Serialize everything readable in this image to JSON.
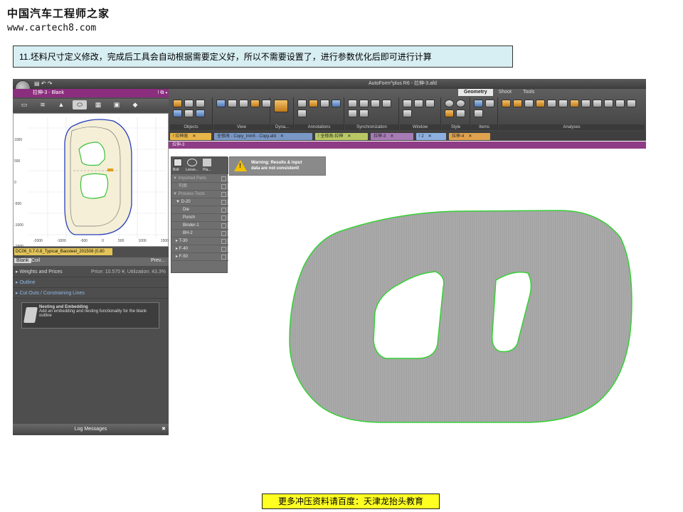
{
  "watermark": {
    "title_cn": "中国汽车工程师之家",
    "url": "www.cartech8.com"
  },
  "step_text": "11.坯料尺寸定义修改，完成后工具会自动根据需要定义好，所以不需要设置了，进行参数优化后即可进行计算",
  "footer_text": "更多冲压资料请百度：天津龙抬头教育",
  "app": {
    "window_title": "AutoForm^plus R6 - 拉伸-3.afd",
    "left_panel": {
      "header": "拉伸-3 - Blank",
      "tools": [
        "cube-icon",
        "layers-icon",
        "mountain-icon",
        "blank-outline-icon",
        "printer-icon",
        "monitor-icon",
        "shield-icon"
      ],
      "plot_label": "DC06_0.7-0.8_Typical_Baosteel_201508 (0.80 mm)",
      "y_ticks": [
        "1000",
        "500",
        "0",
        "-500",
        "-1000",
        "-1500"
      ],
      "x_ticks": [
        "-2000",
        "-1000",
        "-500",
        "0",
        "500",
        "1000",
        "1500"
      ],
      "tabs": [
        "Blank",
        "Coil",
        "Prev..."
      ],
      "rows": [
        {
          "label": "Weights and Prices",
          "value": "Price: 10.570 ¥, Utilization: 43.3%"
        },
        {
          "label": "Outline",
          "value": ""
        },
        {
          "label": "Cut Outs / Constraining Lines",
          "value": ""
        }
      ],
      "nesting_title": "Nesting and Embedding",
      "nesting_desc": "Add an embedding and nesting functionality for the blank outline",
      "log_label": "Log Messages"
    },
    "ribbon": {
      "tabs": [
        "Geometry",
        "Shoot",
        "Tools"
      ],
      "active_tab": "Geometry",
      "groups": [
        "Objects",
        "View",
        "Dyna...",
        "Annotations",
        "Synchronization",
        "Window",
        "Style",
        "Items",
        "Analyses"
      ]
    },
    "doc_tabs": [
      {
        "label": "! 拉伸底",
        "color": "#e8b54a"
      },
      {
        "label": "全修改 - Copy_trim5 - Copy.afd",
        "color": "#7a98c6"
      },
      {
        "label": "! 全修改-拉伸",
        "color": "#b9c864"
      },
      {
        "label": "拉伸-3",
        "color": "#a77bb5"
      },
      {
        "label": "! 2",
        "color": "#8db0e0"
      },
      {
        "label": "拉伸-4",
        "color": "#e0a24e"
      }
    ],
    "purple_bar_label": "拉伸-3",
    "tree": {
      "items": [
        {
          "label": "▼ Imported Parts",
          "indent": 0,
          "dim": true
        },
        {
          "label": "构面",
          "indent": 1,
          "dim": true
        },
        {
          "label": "▼ Process Tools",
          "indent": 0,
          "dim": true
        },
        {
          "label": "▼ D-20",
          "indent": 1,
          "dim": false
        },
        {
          "label": "Die",
          "indent": 2,
          "dim": false
        },
        {
          "label": "Punch",
          "indent": 2,
          "dim": false
        },
        {
          "label": "Binder-1",
          "indent": 2,
          "dim": false
        },
        {
          "label": "BH-2",
          "indent": 2,
          "dim": false
        },
        {
          "label": "▸ T-30",
          "indent": 1,
          "dim": false
        },
        {
          "label": "▸ F-40",
          "indent": 1,
          "dim": false
        },
        {
          "label": "▸ F-50",
          "indent": 1,
          "dim": false
        }
      ],
      "top_labels": [
        "Bolt",
        "Lense...",
        "Pla..."
      ]
    },
    "warning": {
      "line1": "Warning: Results & input",
      "line2": "data are not consistent!"
    },
    "colors": {
      "blank_fill": "#a9a9a9",
      "blank_outline": "#35d135",
      "accent_purple": "#8e3c86"
    }
  }
}
